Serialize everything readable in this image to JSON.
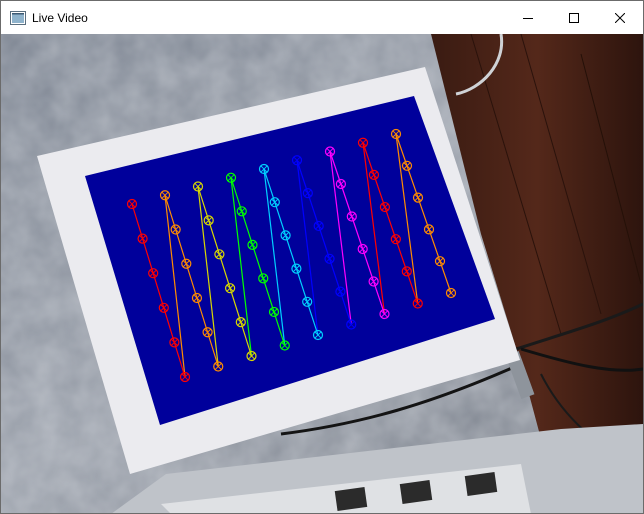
{
  "window": {
    "title": "Live Video",
    "controls": {
      "minimize_icon": "minimize-icon",
      "maximize_icon": "maximize-icon",
      "close_icon": "close-icon"
    }
  },
  "scene": {
    "pattern_background": "#00009b",
    "paper_color": "#ebebef",
    "grid_columns": 9,
    "dots_per_column": 6,
    "column_colors": [
      "#ff0000",
      "#ff8c00",
      "#d8d800",
      "#00ff00",
      "#00d0ff",
      "#0000ff",
      "#ff00ff",
      "#ff0000",
      "#ff8c00"
    ]
  }
}
